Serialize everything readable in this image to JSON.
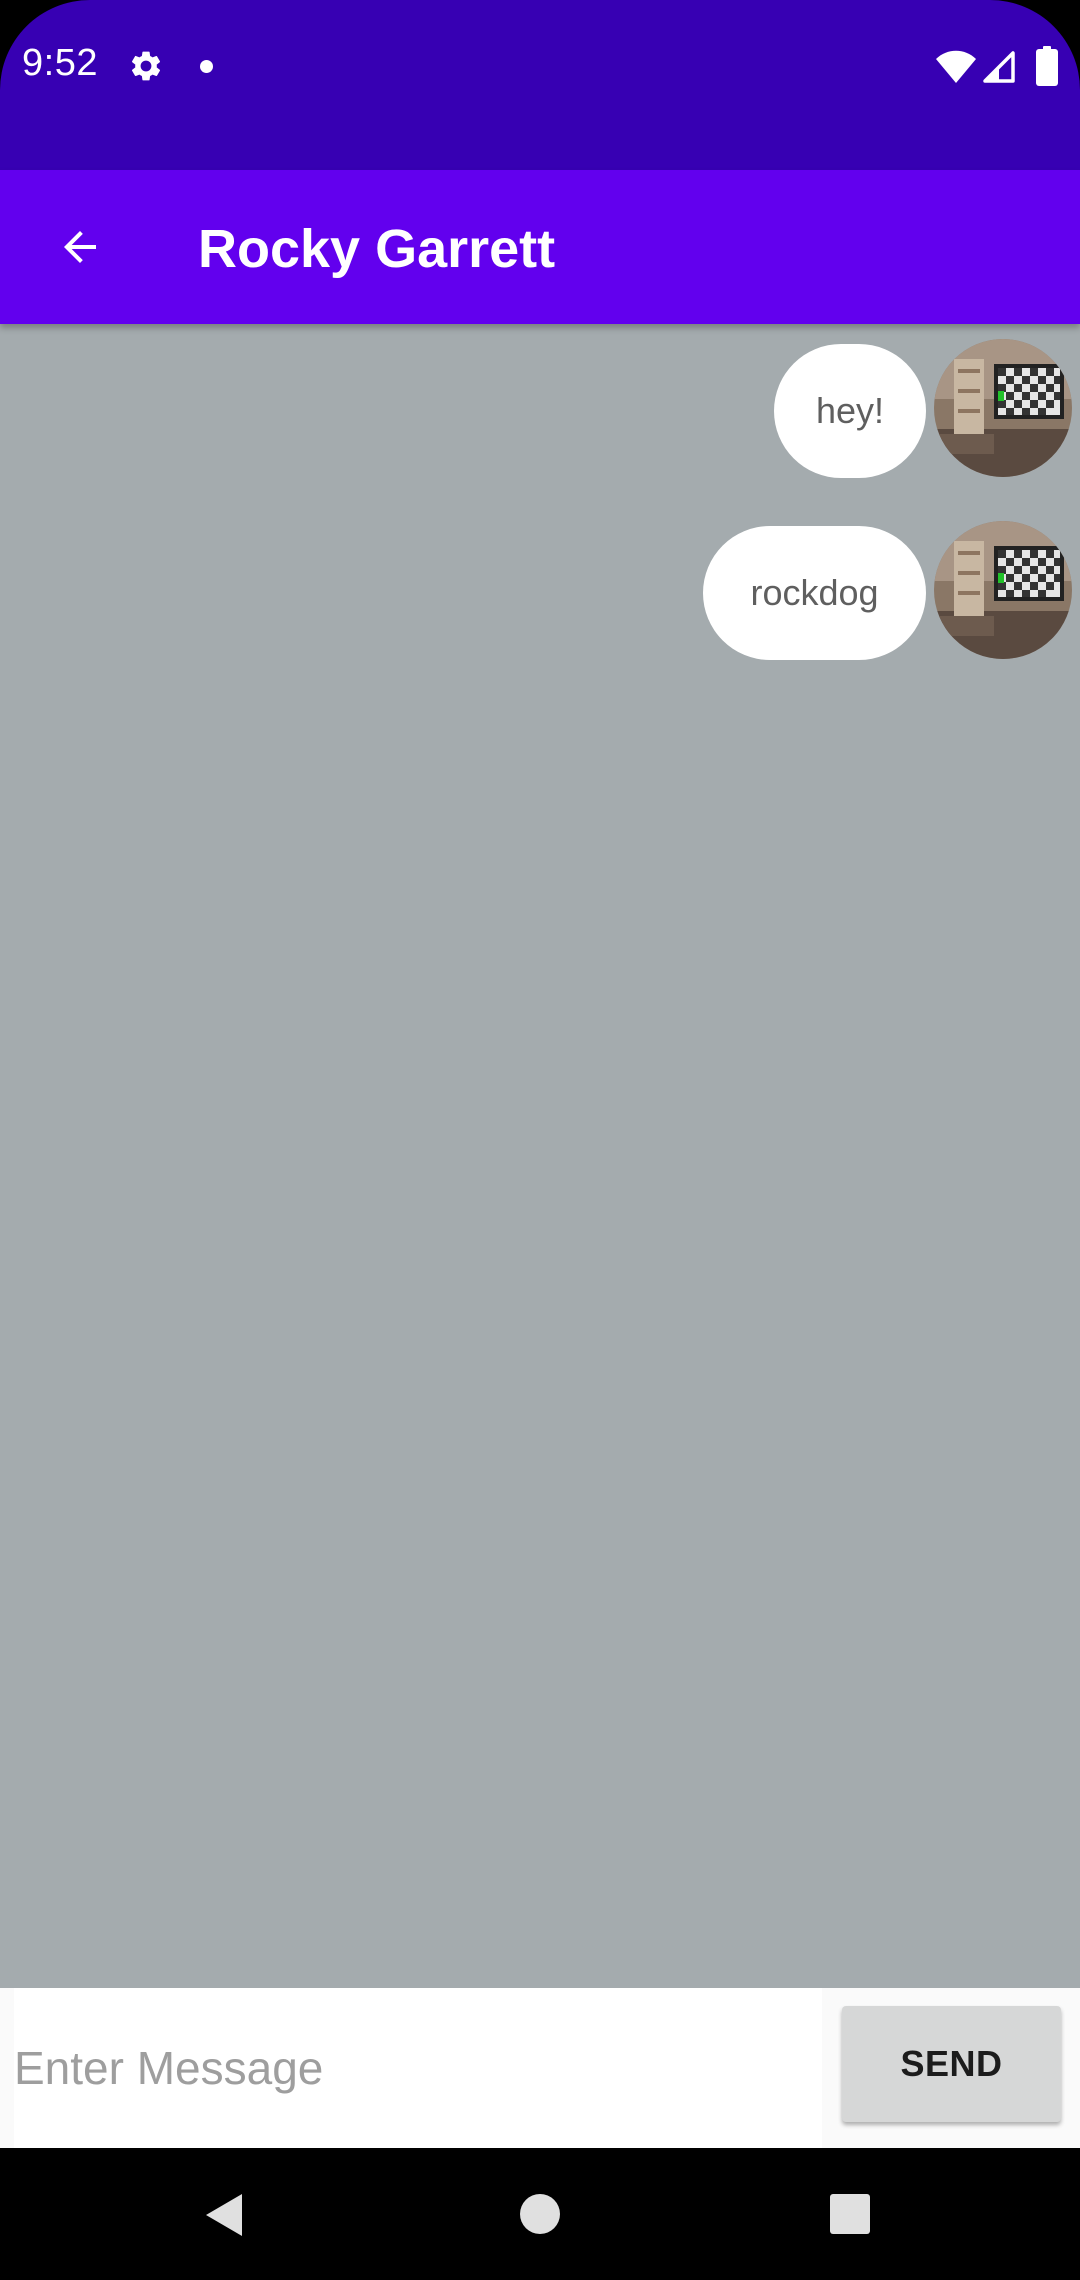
{
  "status_bar": {
    "time": "9:52",
    "icons": [
      "gear-icon",
      "notification-dot-icon",
      "wifi-icon",
      "signal-icon",
      "battery-icon"
    ],
    "background_color": "#3700b3"
  },
  "app_bar": {
    "title": "Rocky Garrett",
    "back_icon": "arrow-left-icon",
    "background_color": "#6200ee"
  },
  "chat": {
    "background_color": "#a4abae",
    "messages": [
      {
        "text": "hey!",
        "avatar": "room-photo-avatar"
      },
      {
        "text": "rockdog",
        "avatar": "room-photo-avatar"
      }
    ]
  },
  "composer": {
    "placeholder": "Enter Message",
    "value": "",
    "send_label": "SEND"
  },
  "nav_bar": {
    "icons": [
      "back-triangle-icon",
      "home-circle-icon",
      "recents-square-icon"
    ]
  }
}
